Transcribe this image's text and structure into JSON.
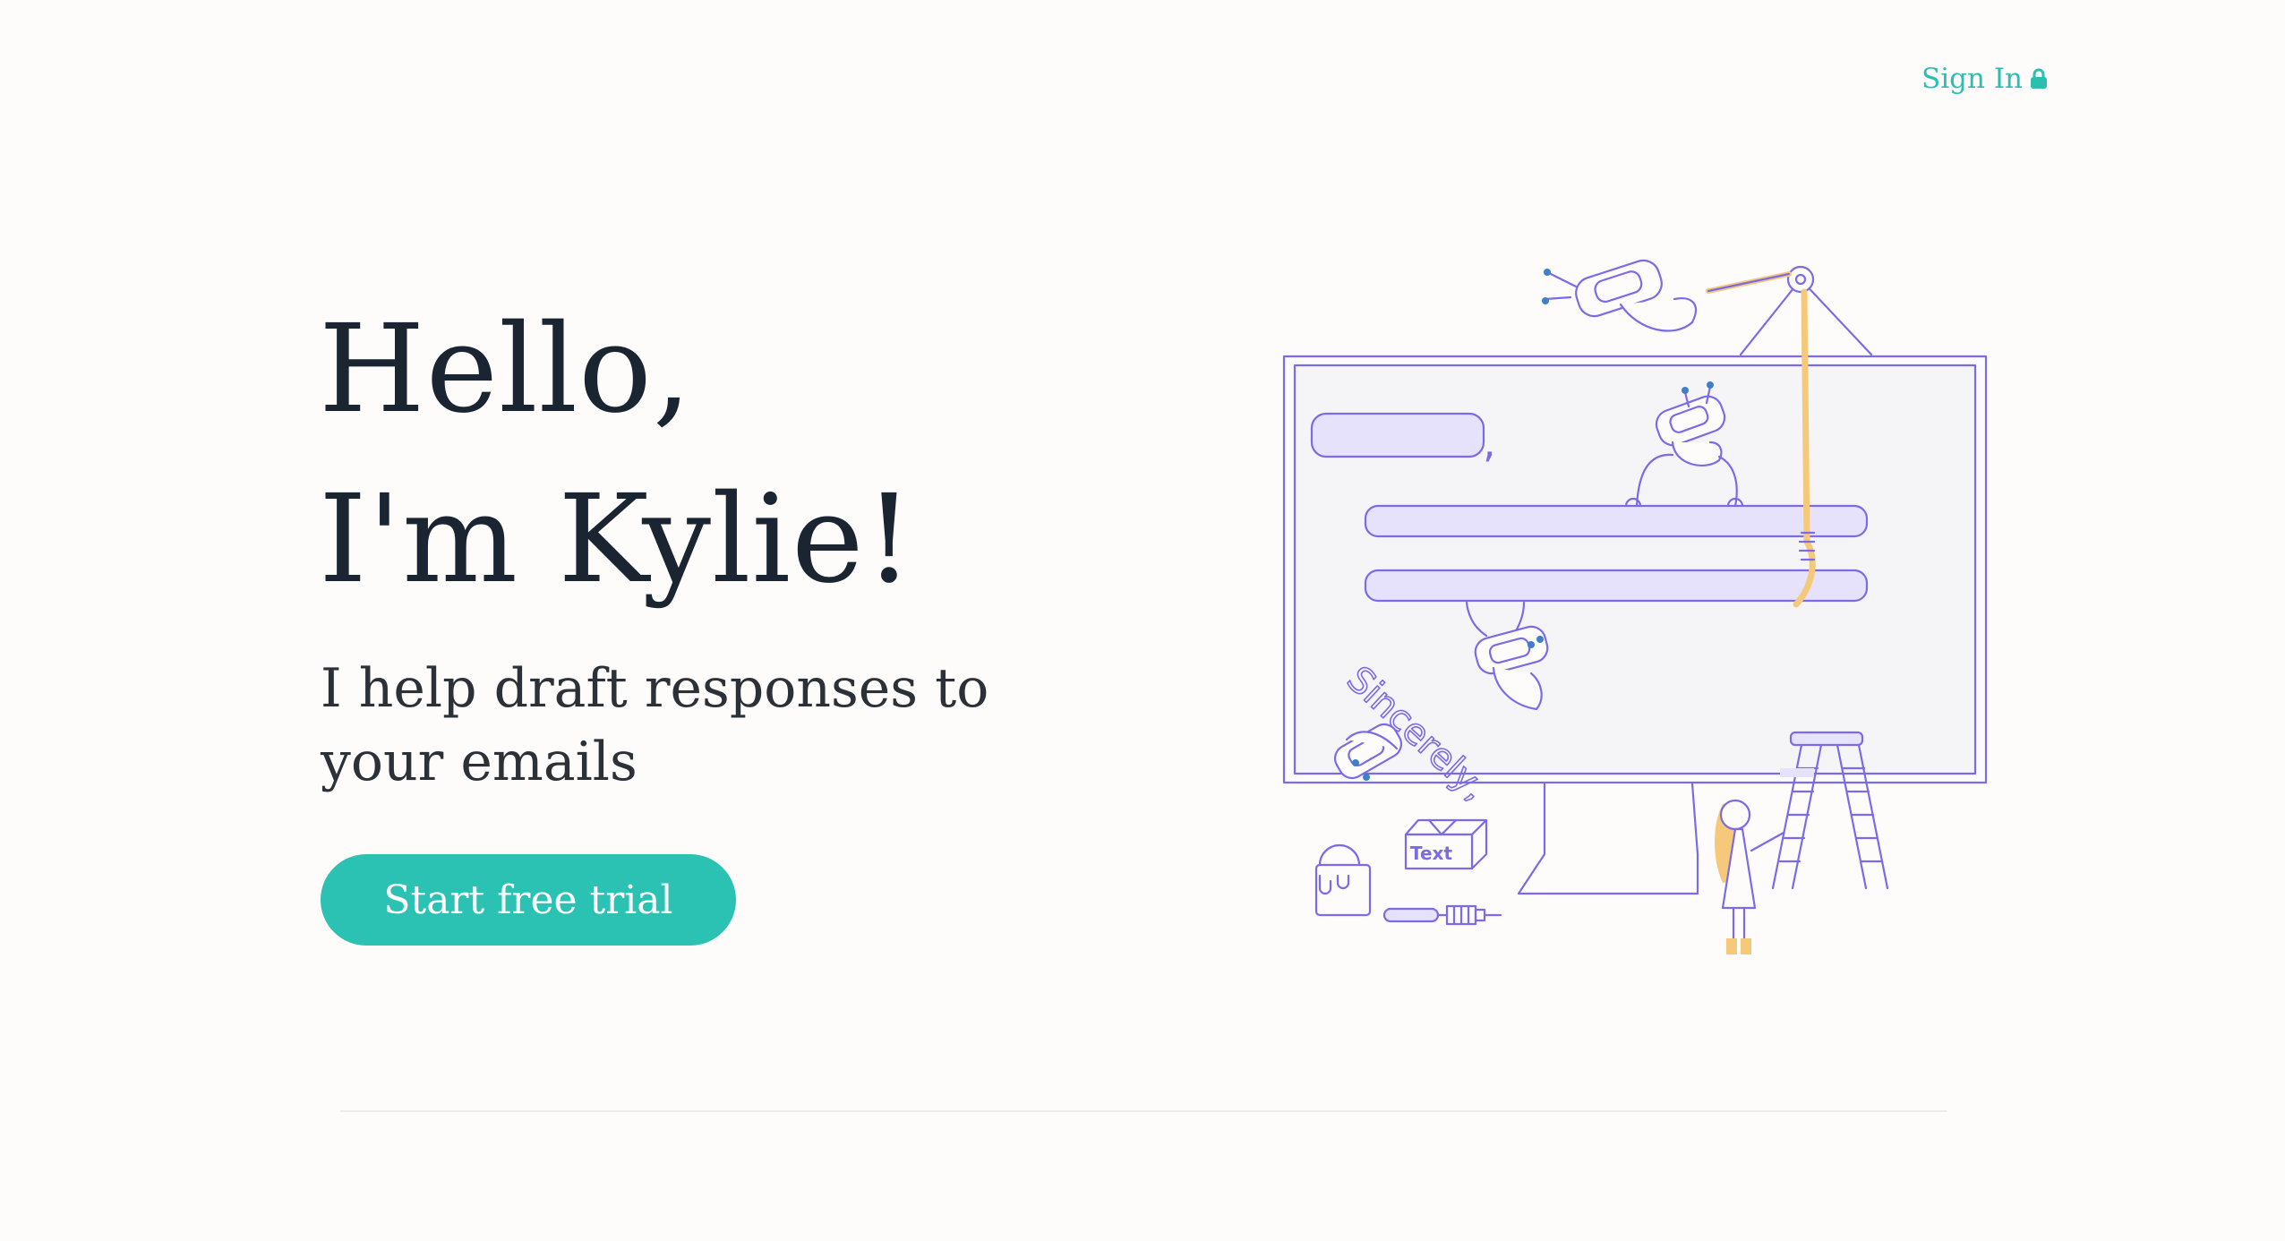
{
  "nav": {
    "sign_in_label": "Sign In",
    "sign_in_icon": "lock-icon"
  },
  "hero": {
    "headline_line1": "Hello,",
    "headline_line2": "I'm Kylie!",
    "subtitle": "I help draft responses to your emails",
    "cta_label": "Start free trial"
  },
  "illustration": {
    "comma": ",",
    "signoff_text": "Sincerely,",
    "box_label": "Text"
  },
  "colors": {
    "accent": "#2bc1b3",
    "headline": "#1b2532",
    "illustration_stroke": "#7b6be6",
    "illustration_fill": "#e6e2fb",
    "rope": "#f6c97a"
  }
}
